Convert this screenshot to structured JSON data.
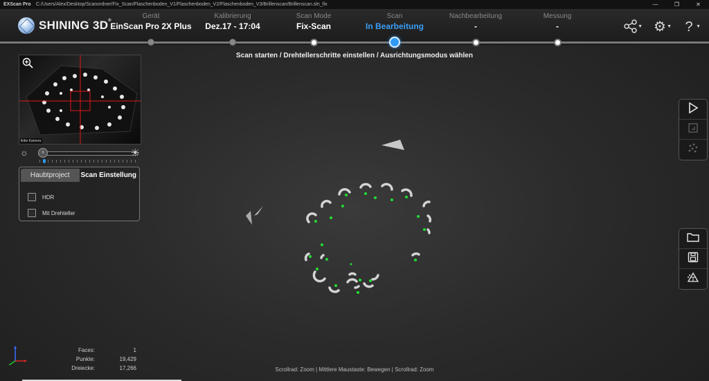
{
  "window": {
    "app_title": "EXScan Pro",
    "path": "C:/Users/Alex/Desktop/Scanordner/Fix_Scan/Flaschenboden_V1/Flaschenboden_V2/Flaschenboden_V3/Brillenscan/Brillenscan.sln_fix",
    "minimize": "—",
    "maximize": "❐",
    "close": "✕"
  },
  "brand": {
    "name": "SHINING 3D",
    "mark": "®"
  },
  "steps": [
    {
      "label": "Gerät",
      "value": "EinScan Pro 2X Plus",
      "state": "done"
    },
    {
      "label": "Kalibrierung",
      "value": "Dez.17 - 17:04",
      "state": "done"
    },
    {
      "label": "Scan Mode",
      "value": "Fix-Scan",
      "state": "pending"
    },
    {
      "label": "Scan",
      "value": "In Bearbeitung",
      "state": "active"
    },
    {
      "label": "Nachbearbeitung",
      "value": "-",
      "state": "pending"
    },
    {
      "label": "Messung",
      "value": "-",
      "state": "pending"
    }
  ],
  "header_icons": [
    "share-icon",
    "settings-icon",
    "help-icon"
  ],
  "instruction": "Scan starten / Drehtellerschritte einstellen / Ausrichtungsmodus wählen",
  "camera": {
    "label": "linke Kamera",
    "brightness_value": "0"
  },
  "panel": {
    "tabs": [
      "Haubtproject",
      "Scan Einstellung"
    ],
    "active_tab": 1,
    "options": [
      {
        "label": "HDR",
        "checked": false
      },
      {
        "label": "Mit Drehteller",
        "checked": false
      }
    ]
  },
  "right_toolbar_top": [
    "play-icon",
    "crop-icon",
    "points-icon"
  ],
  "right_toolbar_bottom": [
    "folder-icon",
    "save-icon",
    "mesh-icon"
  ],
  "stats": [
    {
      "key": "Faces:",
      "value": "1"
    },
    {
      "key": "Punkte:",
      "value": "19,429"
    },
    {
      "key": "Dreiecke:",
      "value": "17,266"
    }
  ],
  "status": "Scrollrad: Zoom | Mittlere Maustaste: Bewegen | Scrollrad: Zoom",
  "colors": {
    "accent": "#2f9af5",
    "marker": "#22dd33"
  }
}
